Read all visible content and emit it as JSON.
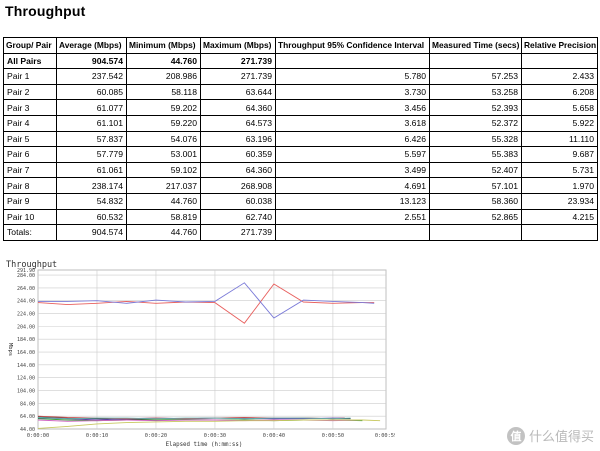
{
  "page": {
    "title": "Throughput"
  },
  "table": {
    "headers": [
      "Group/ Pair",
      "Average (Mbps)",
      "Minimum (Mbps)",
      "Maximum (Mbps)",
      "Throughput 95% Confidence Interval",
      "Measured Time (secs)",
      "Relative Precision"
    ],
    "rows": [
      {
        "label": "All Pairs",
        "bold": true,
        "values": [
          "904.574",
          "44.760",
          "271.739",
          "",
          "",
          ""
        ]
      },
      {
        "label": "Pair 1",
        "bold": false,
        "values": [
          "237.542",
          "208.986",
          "271.739",
          "5.780",
          "57.253",
          "2.433"
        ]
      },
      {
        "label": "Pair 2",
        "bold": false,
        "values": [
          "60.085",
          "58.118",
          "63.644",
          "3.730",
          "53.258",
          "6.208"
        ]
      },
      {
        "label": "Pair 3",
        "bold": false,
        "values": [
          "61.077",
          "59.202",
          "64.360",
          "3.456",
          "52.393",
          "5.658"
        ]
      },
      {
        "label": "Pair 4",
        "bold": false,
        "values": [
          "61.101",
          "59.220",
          "64.573",
          "3.618",
          "52.372",
          "5.922"
        ]
      },
      {
        "label": "Pair 5",
        "bold": false,
        "values": [
          "57.837",
          "54.076",
          "63.196",
          "6.426",
          "55.328",
          "11.110"
        ]
      },
      {
        "label": "Pair 6",
        "bold": false,
        "values": [
          "57.779",
          "53.001",
          "60.359",
          "5.597",
          "55.383",
          "9.687"
        ]
      },
      {
        "label": "Pair 7",
        "bold": false,
        "values": [
          "61.061",
          "59.102",
          "64.360",
          "3.499",
          "52.407",
          "5.731"
        ]
      },
      {
        "label": "Pair 8",
        "bold": false,
        "values": [
          "238.174",
          "217.037",
          "268.908",
          "4.691",
          "57.101",
          "1.970"
        ]
      },
      {
        "label": "Pair 9",
        "bold": false,
        "values": [
          "54.832",
          "44.760",
          "60.038",
          "13.123",
          "58.360",
          "23.934"
        ]
      },
      {
        "label": "Pair 10",
        "bold": false,
        "values": [
          "60.532",
          "58.819",
          "62.740",
          "2.551",
          "52.865",
          "4.215"
        ]
      },
      {
        "label": "Totals:",
        "bold": false,
        "values": [
          "904.574",
          "44.760",
          "271.739",
          "",
          "",
          ""
        ]
      }
    ]
  },
  "chart_data": {
    "type": "line",
    "title": "Throughput",
    "xlabel": "Elapsed time (h:mm:ss)",
    "ylabel": "Mbps",
    "xlim": [
      0,
      59
    ],
    "ylim": [
      44,
      291.9
    ],
    "x_ticks": [
      "0:00:00",
      "0:00:10",
      "0:00:20",
      "0:00:30",
      "0:00:40",
      "0:00:50",
      "0:00:59"
    ],
    "x_tick_values": [
      0,
      10,
      20,
      30,
      40,
      50,
      59
    ],
    "y_ticks": [
      "291.90",
      "284.00",
      "264.00",
      "244.00",
      "224.00",
      "204.00",
      "184.00",
      "164.00",
      "144.00",
      "124.00",
      "104.00",
      "84.00",
      "64.00",
      "44.00"
    ],
    "y_tick_values": [
      291.9,
      284,
      264,
      244,
      224,
      204,
      184,
      164,
      144,
      124,
      104,
      84,
      64,
      44
    ],
    "grid": true,
    "series": [
      {
        "color": "#e8605e",
        "x": [
          0,
          5,
          10,
          15,
          20,
          25,
          30,
          35,
          40,
          45,
          50,
          55,
          57
        ],
        "y": [
          241,
          238,
          240,
          243,
          240,
          242,
          241,
          209,
          270,
          242,
          240,
          241,
          241
        ]
      },
      {
        "color": "#7a7ad8",
        "x": [
          0,
          5,
          10,
          15,
          20,
          25,
          30,
          35,
          40,
          45,
          50,
          55,
          57
        ],
        "y": [
          243,
          243,
          244,
          240,
          245,
          242,
          243,
          272,
          217,
          245,
          243,
          241,
          240
        ]
      },
      {
        "color": "#3a3a3a",
        "x": [
          0,
          5,
          10,
          15,
          20,
          25,
          30,
          35,
          40,
          45,
          50,
          53
        ],
        "y": [
          63,
          61,
          60,
          59,
          60,
          60,
          61,
          60,
          60,
          61,
          60,
          60
        ]
      },
      {
        "color": "#5c3ca8",
        "x": [
          0,
          5,
          10,
          15,
          20,
          25,
          30,
          35,
          40,
          45,
          50,
          52
        ],
        "y": [
          61,
          60,
          58,
          60,
          61,
          60,
          61,
          61,
          60,
          60,
          61,
          61
        ]
      },
      {
        "color": "#3aa03a",
        "x": [
          0,
          5,
          10,
          15,
          20,
          25,
          30,
          35,
          40,
          45,
          50,
          55
        ],
        "y": [
          60,
          58,
          57,
          58,
          58,
          59,
          58,
          58,
          57,
          58,
          58,
          57
        ]
      },
      {
        "color": "#d060c0",
        "x": [
          0,
          5,
          10,
          15,
          20,
          25,
          30,
          35,
          40,
          45,
          50,
          55
        ],
        "y": [
          58,
          56,
          57,
          58,
          57,
          58,
          58,
          57,
          58,
          58,
          57,
          58
        ]
      },
      {
        "color": "#c85050",
        "x": [
          0,
          5,
          10,
          15,
          20,
          25,
          30,
          35,
          40,
          45,
          50,
          52
        ],
        "y": [
          64,
          62,
          61,
          60,
          61,
          60,
          61,
          62,
          61,
          61,
          60,
          61
        ]
      },
      {
        "color": "#c8c860",
        "x": [
          0,
          5,
          10,
          15,
          20,
          25,
          30,
          35,
          40,
          45,
          50,
          55,
          58
        ],
        "y": [
          45,
          48,
          52,
          54,
          55,
          56,
          56,
          57,
          57,
          58,
          58,
          58,
          57
        ]
      },
      {
        "color": "#60b0b0",
        "x": [
          0,
          5,
          10,
          15,
          20,
          25,
          30,
          35,
          40,
          45,
          50,
          53
        ],
        "y": [
          62,
          60,
          61,
          61,
          60,
          61,
          61,
          60,
          61,
          61,
          60,
          61
        ]
      }
    ]
  },
  "watermark": {
    "icon_text": "值",
    "text": "什么值得买"
  }
}
